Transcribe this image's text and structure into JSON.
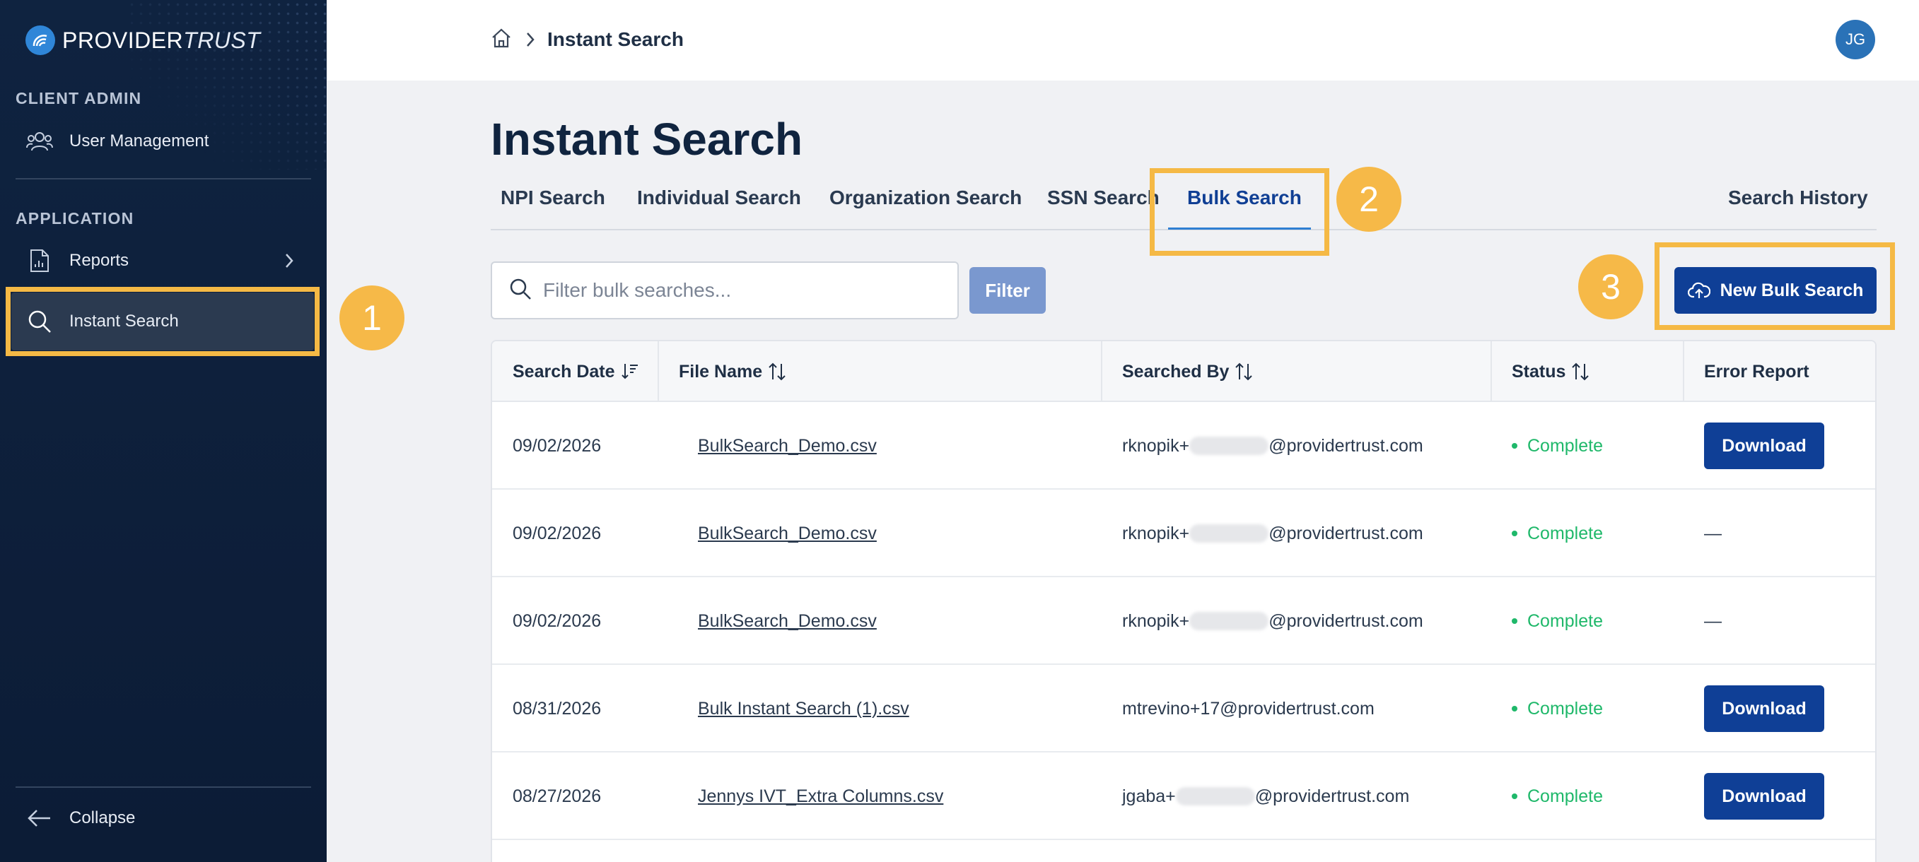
{
  "app": {
    "brand_primary": "PROVIDER",
    "brand_secondary": "TRUST"
  },
  "sidebar": {
    "client_admin_label": "CLIENT ADMIN",
    "user_management_label": "User Management",
    "application_label": "APPLICATION",
    "reports_label": "Reports",
    "instant_search_label": "Instant Search",
    "collapse_label": "Collapse"
  },
  "header": {
    "breadcrumb_current": "Instant Search",
    "avatar_initials": "JG"
  },
  "page": {
    "title": "Instant Search",
    "tabs": [
      {
        "label": "NPI Search"
      },
      {
        "label": "Individual Search"
      },
      {
        "label": "Organization Search"
      },
      {
        "label": "SSN Search"
      },
      {
        "label": "Bulk Search",
        "active": true
      }
    ],
    "search_history_label": "Search History"
  },
  "toolbar": {
    "filter_placeholder": "Filter bulk searches...",
    "filter_label": "Filter",
    "new_bulk_label": "New Bulk Search"
  },
  "annotations": {
    "badge_1": "1",
    "badge_2": "2",
    "badge_3": "3",
    "highlight_color": "#f5b945"
  },
  "table": {
    "columns": [
      "Search Date",
      "File Name",
      "Searched By",
      "Status",
      "Error Report"
    ],
    "rows": [
      {
        "date": "09/02/2026",
        "file": "BulkSearch_Demo.csv",
        "by_prefix": "rknopik+",
        "by_suffix": "@providertrust.com",
        "by_redacted": true,
        "status": "Complete",
        "error_report": "Download"
      },
      {
        "date": "09/02/2026",
        "file": "BulkSearch_Demo.csv",
        "by_prefix": "rknopik+",
        "by_suffix": "@providertrust.com",
        "by_redacted": true,
        "status": "Complete",
        "error_report": "—"
      },
      {
        "date": "09/02/2026",
        "file": "BulkSearch_Demo.csv",
        "by_prefix": "rknopik+",
        "by_suffix": "@providertrust.com",
        "by_redacted": true,
        "status": "Complete",
        "error_report": "—"
      },
      {
        "date": "08/31/2026",
        "file": "Bulk Instant Search (1).csv",
        "by_prefix": "mtrevino+17@providertrust.com",
        "by_suffix": "",
        "by_redacted": false,
        "status": "Complete",
        "error_report": "Download"
      },
      {
        "date": "08/27/2026",
        "file": "Jennys IVT_Extra Columns.csv",
        "by_prefix": "jgaba+",
        "by_suffix": "@providertrust.com",
        "by_redacted": true,
        "status": "Complete",
        "error_report": "Download"
      }
    ]
  },
  "colors": {
    "sidebar_bg": "#0f2340",
    "primary_button": "#0f3f96",
    "status_complete": "#1fb86a",
    "active_tab": "#103f94"
  }
}
